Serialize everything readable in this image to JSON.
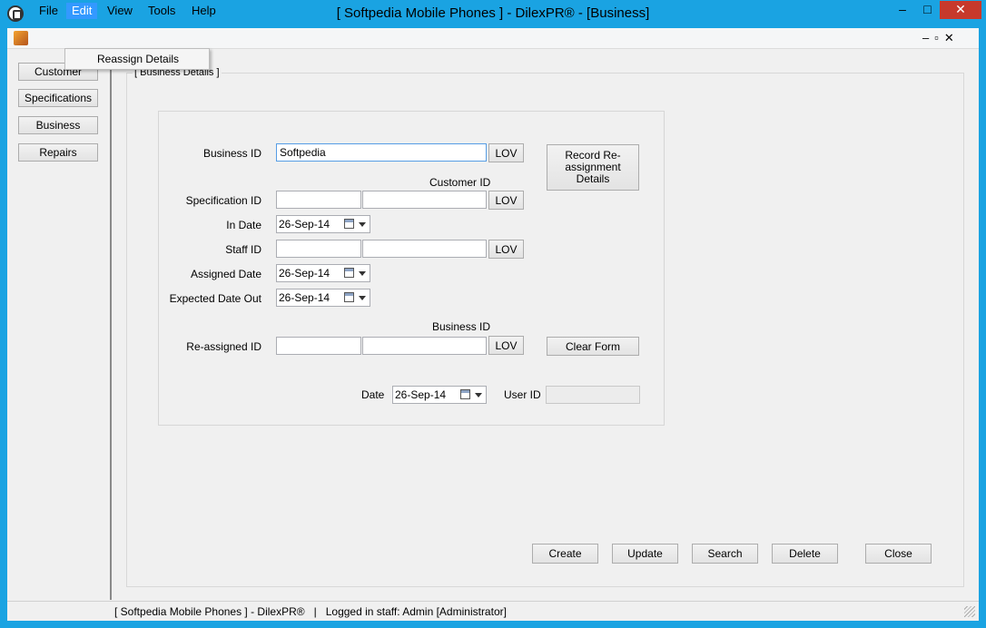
{
  "window": {
    "title": "[ Softpedia Mobile Phones ] - DilexPR® - [Business]",
    "minimize_glyph": "–",
    "maximize_glyph": "□",
    "close_glyph": "✕"
  },
  "menubar": {
    "items": [
      {
        "label": "File"
      },
      {
        "label": "Edit"
      },
      {
        "label": "View"
      },
      {
        "label": "Tools"
      },
      {
        "label": "Help"
      }
    ],
    "mdi_controls": "–▫✕"
  },
  "edit_menu": {
    "items": [
      {
        "label": "Reassign Details"
      }
    ]
  },
  "sidebar": {
    "items": [
      {
        "label": "Customer"
      },
      {
        "label": "Specifications"
      },
      {
        "label": "Business"
      },
      {
        "label": "Repairs"
      }
    ]
  },
  "form": {
    "group_title": "[ Business Details ]",
    "labels": {
      "business_id": "Business ID",
      "customer_id_header": "Customer ID",
      "specification_id": "Specification ID",
      "in_date": "In Date",
      "staff_id": "Staff ID",
      "assigned_date": "Assigned Date",
      "expected_date_out": "Expected Date Out",
      "business_id_header": "Business ID",
      "reassigned_id": "Re-assigned ID",
      "date": "Date",
      "user_id": "User ID"
    },
    "values": {
      "business_id": "Softpedia",
      "specification_id_a": "",
      "specification_id_b": "",
      "in_date": "26-Sep-14",
      "staff_id_a": "",
      "staff_id_b": "",
      "assigned_date": "26-Sep-14",
      "expected_date_out": "26-Sep-14",
      "reassigned_id_a": "",
      "reassigned_id_b": "",
      "date": "26-Sep-14",
      "user_id": ""
    },
    "lov_label": "LOV",
    "record_button": "Record Re-assignment Details",
    "clear_button": "Clear Form"
  },
  "actions": {
    "create": "Create",
    "update": "Update",
    "search": "Search",
    "delete": "Delete",
    "close": "Close"
  },
  "status": {
    "text": "[ Softpedia Mobile Phones ] - DilexPR®   |   Logged in staff: Admin [Administrator]"
  },
  "colors": {
    "window_border": "#1aa3e2",
    "menu_highlight": "#3399ff",
    "close_button": "#c7392b"
  }
}
